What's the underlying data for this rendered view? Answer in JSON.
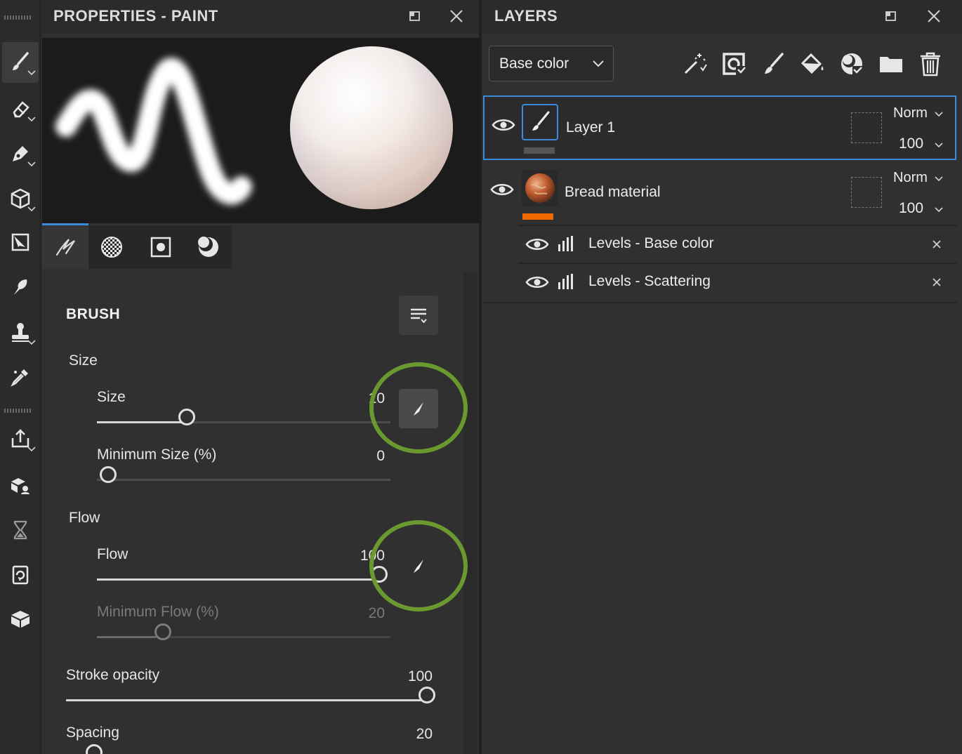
{
  "properties_panel": {
    "title": "PROPERTIES - PAINT",
    "section_title": "BRUSH",
    "groups": {
      "size": "Size",
      "flow": "Flow"
    },
    "params": {
      "size": {
        "label": "Size",
        "value": "10",
        "fraction": 0.3
      },
      "min_size": {
        "label": "Minimum Size (%)",
        "value": "0",
        "fraction": 0.0
      },
      "flow": {
        "label": "Flow",
        "value": "100",
        "fraction": 1.0
      },
      "min_flow": {
        "label": "Minimum Flow (%)",
        "value": "20",
        "fraction": 0.2,
        "disabled": true
      },
      "stroke_opacity": {
        "label": "Stroke opacity",
        "value": "100",
        "fraction": 1.0
      },
      "spacing": {
        "label": "Spacing",
        "value": "20",
        "fraction": 0.06
      }
    },
    "tabs": [
      "brush-icon",
      "checker-alpha-icon",
      "stencil-icon",
      "material-icon"
    ],
    "active_tab": 0
  },
  "layers_panel": {
    "title": "LAYERS",
    "channel": "Base color",
    "toolbar_icons": [
      "magic-wand-icon",
      "fill-layer-icon",
      "paint-layer-icon",
      "fill-bucket-icon",
      "smart-material-icon",
      "folder-icon",
      "trash-icon"
    ],
    "layers": [
      {
        "name": "Layer 1",
        "blend": "Norm",
        "opacity": "100",
        "color_tag": "#555555",
        "selected": true
      },
      {
        "name": "Bread material",
        "blend": "Norm",
        "opacity": "100",
        "color_tag": "#ef6a00",
        "selected": false
      }
    ],
    "effects": [
      {
        "name": "Levels - Base color"
      },
      {
        "name": "Levels - Scattering"
      }
    ]
  },
  "colors": {
    "accent_blue": "#3a8be0",
    "highlight_ring": "#6a9a2f",
    "bread_tag": "#ef6a00"
  }
}
